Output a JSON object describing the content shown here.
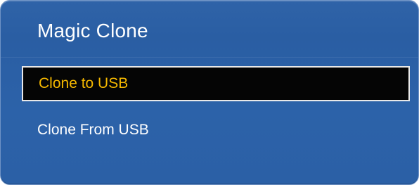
{
  "osd": {
    "title": "Magic Clone",
    "menu_items": [
      {
        "label": "Clone to USB",
        "selected": true
      },
      {
        "label": "Clone From USB",
        "selected": false
      }
    ],
    "colors": {
      "panel_background": "#2c62a9",
      "selected_background": "#050505",
      "selected_border": "#e9e9e9",
      "selected_text": "#f5b800",
      "normal_text": "#ffffff"
    }
  }
}
